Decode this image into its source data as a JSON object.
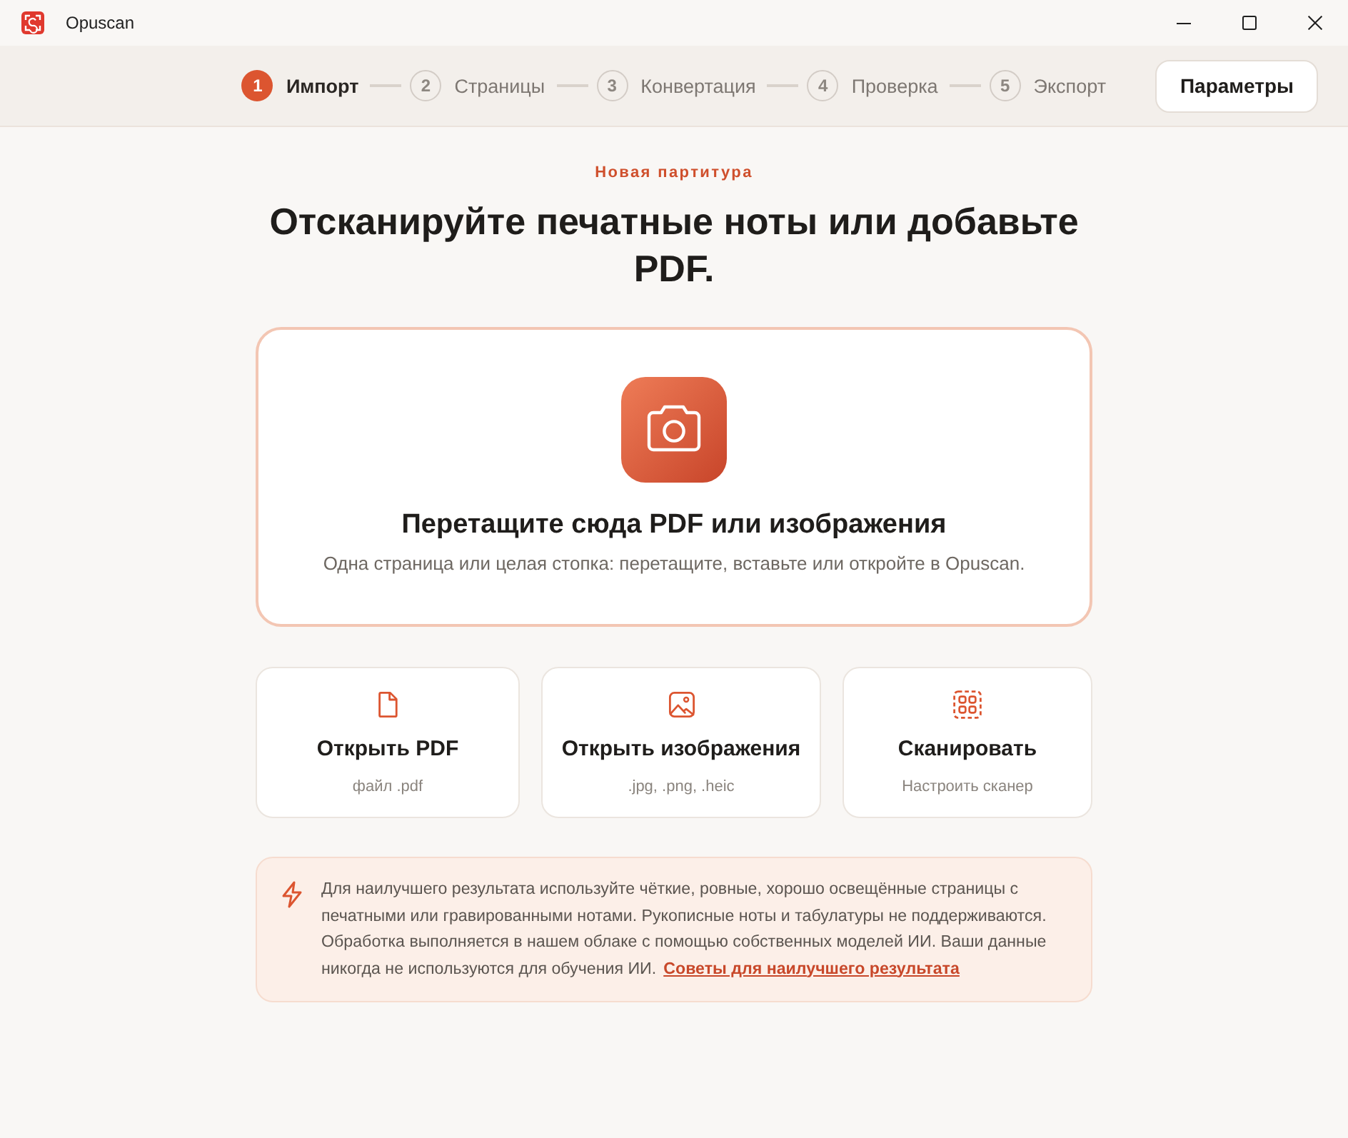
{
  "window": {
    "title": "Opuscan"
  },
  "stepper": {
    "steps": [
      {
        "number": "1",
        "label": "Импорт",
        "selected": true
      },
      {
        "number": "2",
        "label": "Страницы",
        "selected": false
      },
      {
        "number": "3",
        "label": "Конвертация",
        "selected": false
      },
      {
        "number": "4",
        "label": "Проверка",
        "selected": false
      },
      {
        "number": "5",
        "label": "Экспорт",
        "selected": false
      }
    ]
  },
  "settings_button": "Параметры",
  "eyebrow": "Новая партитура",
  "heading": "Отсканируйте печатные ноты или добавьте PDF.",
  "drop_zone": {
    "title": "Перетащите сюда PDF или изображения",
    "subtitle": "Одна страница или целая стопка: перетащите, вставьте или откройте в Opuscan."
  },
  "actions": [
    {
      "kind": "pdf",
      "title": "Открыть PDF",
      "subtitle": "файл .pdf"
    },
    {
      "kind": "image",
      "title": "Открыть изображения",
      "subtitle": ".jpg, .png, .heic"
    },
    {
      "kind": "scan",
      "title": "Сканировать",
      "subtitle": "Настроить сканер"
    }
  ],
  "tip": {
    "text": "Для наилучшего результата используйте чёткие, ровные, хорошо освещённые страницы с печатными или гравированными нотами. Рукописные ноты и табулатуры не поддерживаются. Обработка выполняется в нашем облаке с помощью собственных моделей ИИ. Ваши данные никогда не используются для обучения ИИ.",
    "link": "Советы для наилучшего результата"
  }
}
